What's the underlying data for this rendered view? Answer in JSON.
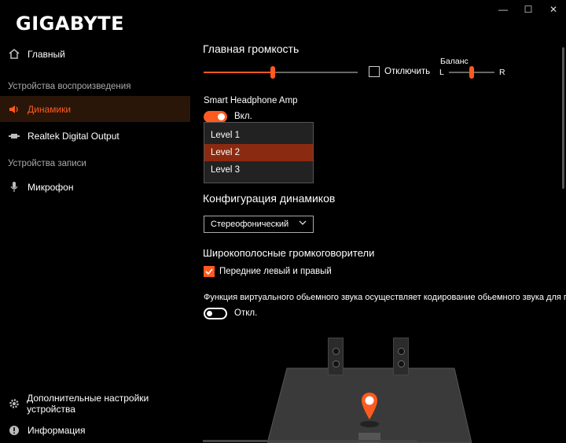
{
  "window": {
    "minimize": "—",
    "maximize": "☐",
    "close": "✕"
  },
  "brand": "GIGABYTE",
  "sidebar": {
    "home": "Главный",
    "playback_section": "Устройства воспроизведения",
    "speakers": "Динамики",
    "digital_out": "Realtek Digital Output",
    "record_section": "Устройства записи",
    "mic": "Микрофон",
    "advanced": "Дополнительные настройки устройства",
    "info": "Информация"
  },
  "volume": {
    "title": "Главная громкость",
    "mute_label": "Отключить",
    "level": 0.45,
    "balance_label": "Баланс",
    "balance_left": "L",
    "balance_right": "R",
    "balance": 0.5
  },
  "amp": {
    "title": "Smart Headphone Amp",
    "toggle_label": "Вкл.",
    "options": [
      "Level 1",
      "Level 2",
      "Level 3"
    ],
    "selected": "Level 2"
  },
  "config": {
    "title": "Конфигурация динамиков",
    "selected": "Стереофонический"
  },
  "fullrange": {
    "title": "Широкополосные громкоговорители",
    "front_label": "Передние левый и правый"
  },
  "virtual": {
    "desc": "Функция виртуального обьемного звука осуществляет кодирование обьемного звука для пере",
    "toggle_label": "Откл."
  },
  "colors": {
    "accent": "#ff5a1f",
    "background": "#000000"
  }
}
